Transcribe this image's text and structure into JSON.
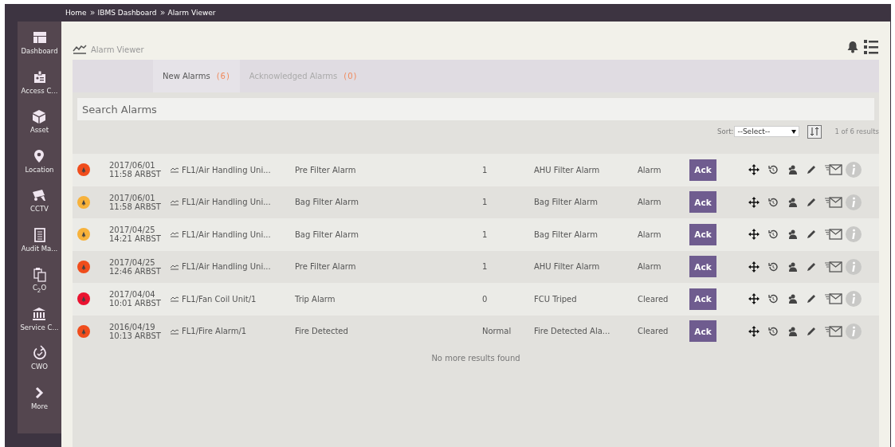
{
  "breadcrumb": [
    "Home",
    "IBMS Dashboard",
    "Alarm Viewer"
  ],
  "sidebar": {
    "items": [
      {
        "label": "Dashboard"
      },
      {
        "label": "Access C..."
      },
      {
        "label": "Asset"
      },
      {
        "label": "Location"
      },
      {
        "label": "CCTV"
      },
      {
        "label": "Audit Ma..."
      },
      {
        "label": "C$_{2}$O"
      },
      {
        "label": "Service C..."
      },
      {
        "label": "CWO"
      },
      {
        "label": "More"
      }
    ]
  },
  "page_title": "Alarm Viewer",
  "tabs": [
    {
      "label": "New Alarms",
      "count": "(6)",
      "selected": true
    },
    {
      "label": "Acknowledged Alarms",
      "count": "(0)",
      "selected": false
    }
  ],
  "search": {
    "placeholder": "Search Alarms"
  },
  "sort": {
    "label": "Sort:",
    "value": "--Select--",
    "results": "1 of 6 results"
  },
  "alarms": [
    {
      "color": "#f04d1c",
      "date": "2017/06/01",
      "time": "11:58 ARBST",
      "point": "FL1/Air Handling Uni...",
      "name": "Pre Filter Alarm",
      "value": "1",
      "description": "AHU Filter Alarm",
      "state": "Alarm",
      "action": "Ack"
    },
    {
      "color": "#f7b23b",
      "date": "2017/06/01",
      "time": "11:58 ARBST",
      "point": "FL1/Air Handling Uni...",
      "name": "Bag Filter Alarm",
      "value": "1",
      "description": "Bag Filter Alarm",
      "state": "Alarm",
      "action": "Ack"
    },
    {
      "color": "#f7b23b",
      "date": "2017/04/25",
      "time": "14:21 ARBST",
      "point": "FL1/Air Handling Uni...",
      "name": "Bag Filter Alarm",
      "value": "1",
      "description": "Bag Filter Alarm",
      "state": "Alarm",
      "action": "Ack"
    },
    {
      "color": "#f04d1c",
      "date": "2017/04/25",
      "time": "12:46 ARBST",
      "point": "FL1/Air Handling Uni...",
      "name": "Pre Filter Alarm",
      "value": "1",
      "description": "AHU Filter Alarm",
      "state": "Alarm",
      "action": "Ack"
    },
    {
      "color": "#ea1330",
      "date": "2017/04/04",
      "time": "10:01 ARBST",
      "point": "FL1/Fan Coil Unit/1",
      "name": "Trip Alarm",
      "value": "0",
      "description": "FCU Triped",
      "state": "Cleared",
      "action": "Ack"
    },
    {
      "color": "#f04d1c",
      "date": "2016/04/19",
      "time": "10:13 ARBST",
      "point": "FL1/Fire Alarm/1",
      "name": "Fire Detected",
      "value": "Normal",
      "description": "Fire Detected Ala...",
      "state": "Cleared",
      "action": "Ack"
    }
  ],
  "footer_note": "No more results found"
}
